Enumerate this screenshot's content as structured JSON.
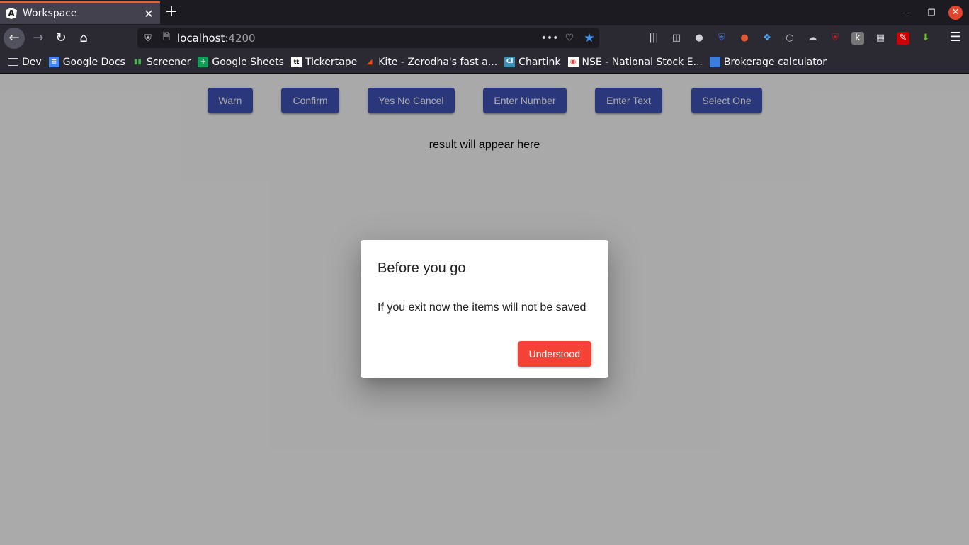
{
  "browser": {
    "tab": {
      "title": "Workspace",
      "favicon": "angular-icon"
    },
    "url": {
      "host": "localhost",
      "port": ":4200"
    },
    "bookmarks": [
      {
        "label": "Dev",
        "icon": "folder-icon"
      },
      {
        "label": "Google Docs",
        "icon": "google-docs-icon"
      },
      {
        "label": "Screener",
        "icon": "screener-icon"
      },
      {
        "label": "Google Sheets",
        "icon": "google-sheets-icon"
      },
      {
        "label": "Tickertape",
        "icon": "tickertape-icon"
      },
      {
        "label": "Kite - Zerodha's fast a...",
        "icon": "kite-icon"
      },
      {
        "label": "Chartink",
        "icon": "chartink-icon"
      },
      {
        "label": "NSE - National Stock E...",
        "icon": "nse-icon"
      },
      {
        "label": "Brokerage calculator",
        "icon": "brokerage-icon"
      }
    ]
  },
  "page": {
    "buttons": [
      {
        "label": "Warn"
      },
      {
        "label": "Confirm"
      },
      {
        "label": "Yes No Cancel"
      },
      {
        "label": "Enter Number"
      },
      {
        "label": "Enter Text"
      },
      {
        "label": "Select One"
      }
    ],
    "result_text": "result will appear here"
  },
  "dialog": {
    "title": "Before you go",
    "message": "If you exit now the items will not be saved",
    "action_label": "Understood"
  },
  "colors": {
    "primary": "#3f51b5",
    "warn": "#f44336",
    "tab_accent": "#e66035"
  }
}
